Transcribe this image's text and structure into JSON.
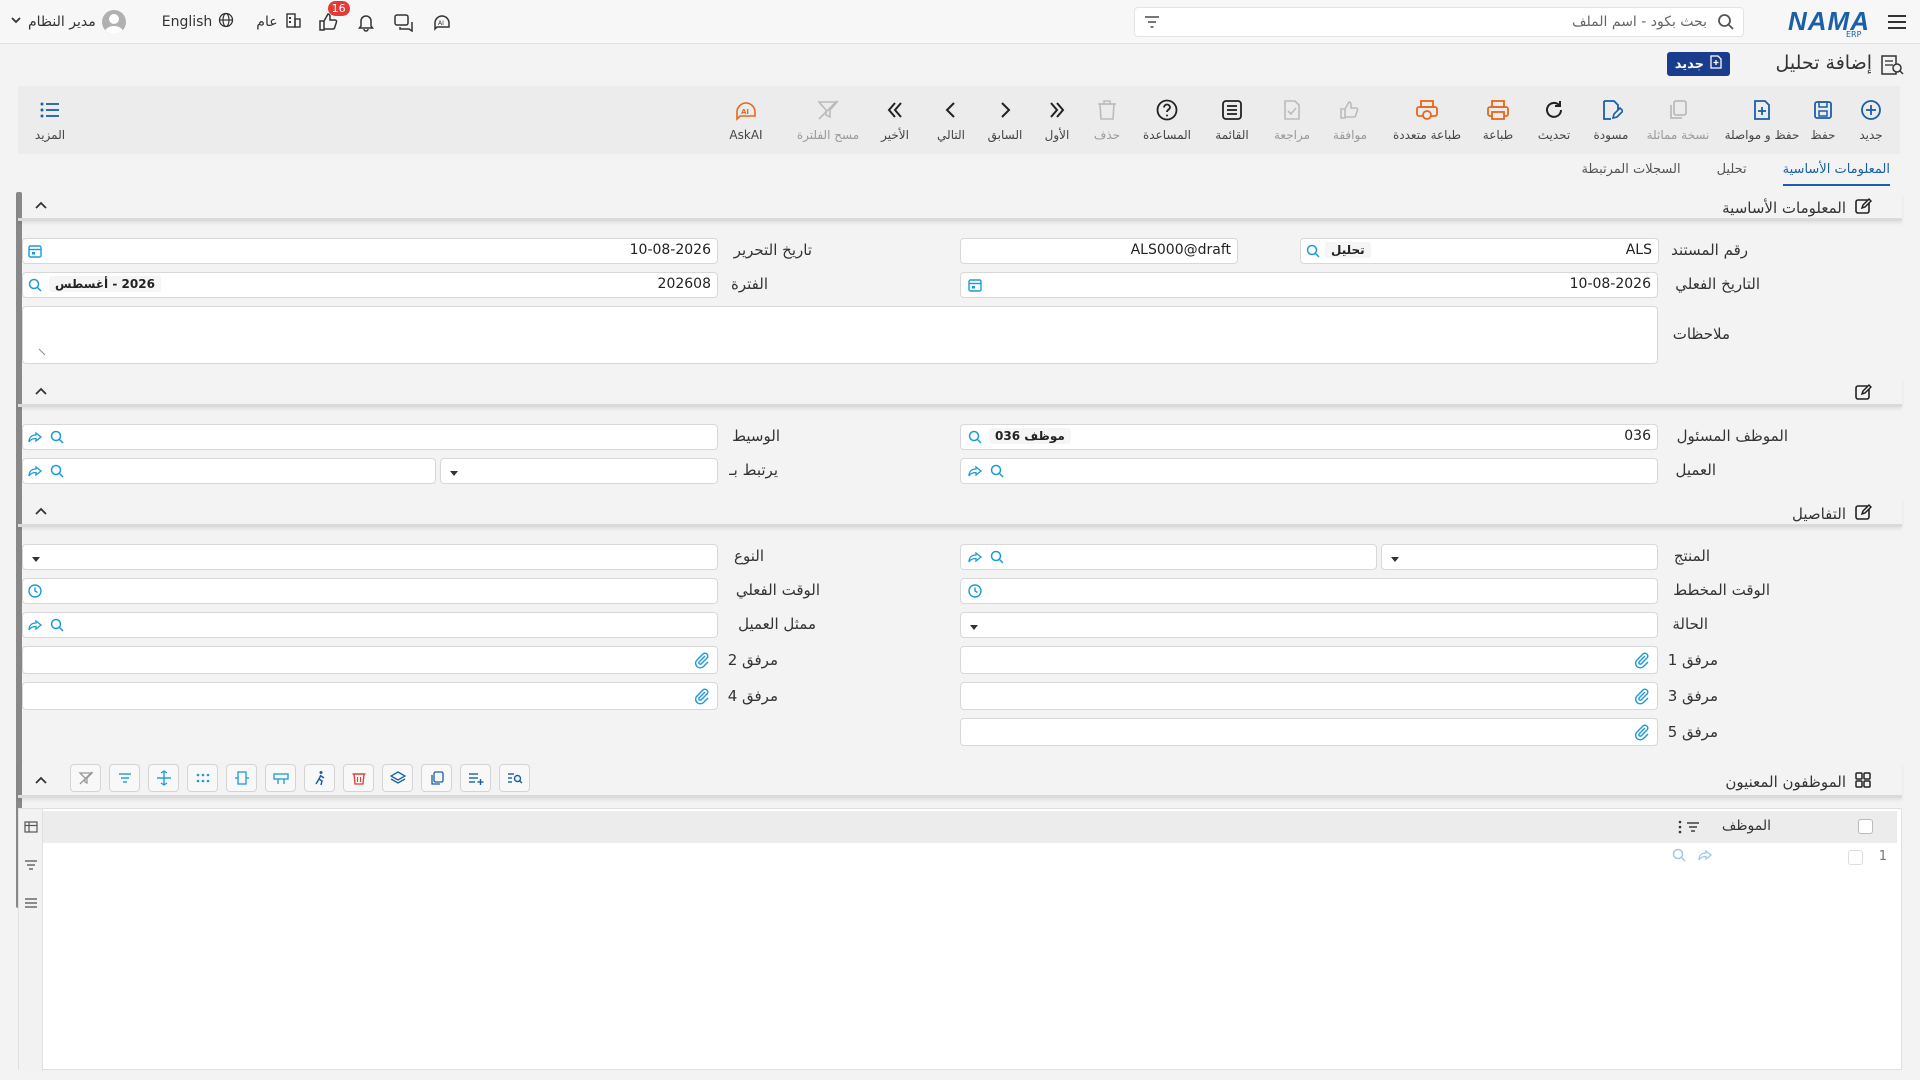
{
  "topbar": {
    "logo_text": "NAMA",
    "logo_sub": "ERP",
    "search_placeholder": "بحث بكود - اسم الملف",
    "user_name": "مدير النظام",
    "language": "English",
    "scope": "عام",
    "notification_count": "16"
  },
  "page": {
    "title": "إضافة تحليل",
    "new_badge": "جديد"
  },
  "toolbar": {
    "new": "جديد",
    "save": "حفظ",
    "save_continue": "حفظ و مواصلة",
    "duplicate": "نسخة مماثلة",
    "draft": "مسودة",
    "refresh": "تحديث",
    "print": "طباعة",
    "multi_print": "طباعة متعددة",
    "approve": "موافقة",
    "review": "مراجعة",
    "list": "القائمة",
    "help": "المساعدة",
    "delete": "حذف",
    "first": "الأول",
    "previous": "السابق",
    "next": "التالي",
    "last": "الأخير",
    "clear_filter": "مسح الفلترة",
    "askai": "AskAI",
    "more": "المزيد"
  },
  "tabs": [
    "المعلومات الأساسية",
    "تحليل",
    "السجلات المرتبطة"
  ],
  "sections": {
    "basic": "المعلومات الأساسية",
    "details": "التفاصيل",
    "employees": "الموظفون المعنيون"
  },
  "fields": {
    "doc_no_label": "رقم المستند",
    "doc_no_prefix": "ALS",
    "doc_no_type": "تحليل",
    "doc_no_value": "ALS000@draft",
    "edit_date_label": "تاريخ التحرير",
    "edit_date_value": "10-08-2026",
    "actual_date_label": "التاريخ الفعلي",
    "actual_date_value": "10-08-2026",
    "period_label": "الفترة",
    "period_value": "202608",
    "period_name": "2026 - أغسطس",
    "notes_label": "ملاحظات",
    "emp_label": "الموظف المسئول",
    "emp_code": "036",
    "emp_name": "موظف 036",
    "broker_label": "الوسيط",
    "customer_label": "العميل",
    "linked_label": "يرتبط بـ",
    "product_label": "المنتج",
    "type_label": "النوع",
    "planned_time_label": "الوقت المخطط",
    "actual_time_label": "الوقت الفعلي",
    "status_label": "الحالة",
    "cust_rep_label": "ممثل العميل",
    "att1_label": "مرفق 1",
    "att2_label": "مرفق 2",
    "att3_label": "مرفق 3",
    "att4_label": "مرفق 4",
    "att5_label": "مرفق 5"
  },
  "grid": {
    "column_employee": "الموظف",
    "row_number": "1"
  },
  "colors": {
    "accent": "#1a5fa8",
    "badge_bg": "#1a3c8c",
    "print_orange": "#e8671c",
    "notification_red": "#e53935"
  }
}
